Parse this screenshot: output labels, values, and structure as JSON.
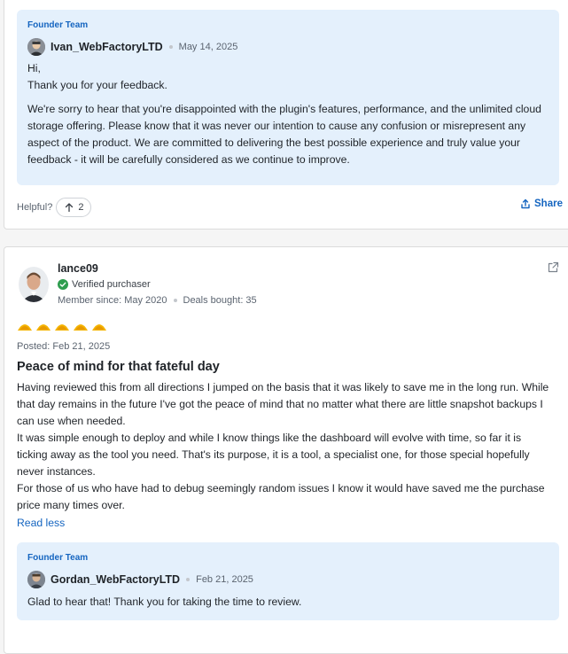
{
  "review1_reply": {
    "badge": "Founder Team",
    "author": "Ivan_WebFactoryLTD",
    "date": "May 14, 2025",
    "paragraphs": [
      "Hi,",
      "Thank you for your feedback.",
      "We're sorry to hear that you're disappointed with the plugin's features, performance, and the unlimited cloud storage offering. Please know that it was never our intention to cause any confusion or misrepresent any aspect of the product. We are committed to delivering the best possible experience and truly value your feedback - it will be carefully considered as we continue to improve."
    ]
  },
  "review1_footer": {
    "helpful_label": "Helpful?",
    "upvotes": "2",
    "share_label": "Share"
  },
  "review2": {
    "reviewer": "lance09",
    "verified_label": "Verified purchaser",
    "member_since": "Member since: May 2020",
    "deals_bought": "Deals bought: 35",
    "rating": 5,
    "rating_max": 5,
    "posted": "Posted: Feb 21, 2025",
    "title": "Peace of mind for that fateful day",
    "body": [
      "Having reviewed this from all directions I jumped on the basis that it was likely to save me in the long run. While that day remains in the future I've got the peace of mind that no matter what there are little snapshot backups I can use when needed.",
      "It was simple enough to deploy and while I know things like the dashboard will evolve with time, so far it is ticking away as the tool you need. That's its purpose, it is a tool, a specialist one, for those special hopefully never instances.",
      "For those of us who have had to debug seemingly random issues I know it would have saved me the purchase price many times over."
    ],
    "read_less": "Read less"
  },
  "review2_reply": {
    "badge": "Founder Team",
    "author": "Gordan_WebFactoryLTD",
    "date": "Feb 21, 2025",
    "text": "Glad to hear that! Thank you for taking the time to review."
  },
  "colors": {
    "accent": "#1565c0",
    "reply_bg": "#e4f0fc",
    "verified": "#2e9d4e",
    "star": "#f5b400"
  },
  "icons": [
    "arrow-up-icon",
    "share-icon",
    "verified-check-icon",
    "external-link-icon",
    "taco-rating-icon"
  ]
}
